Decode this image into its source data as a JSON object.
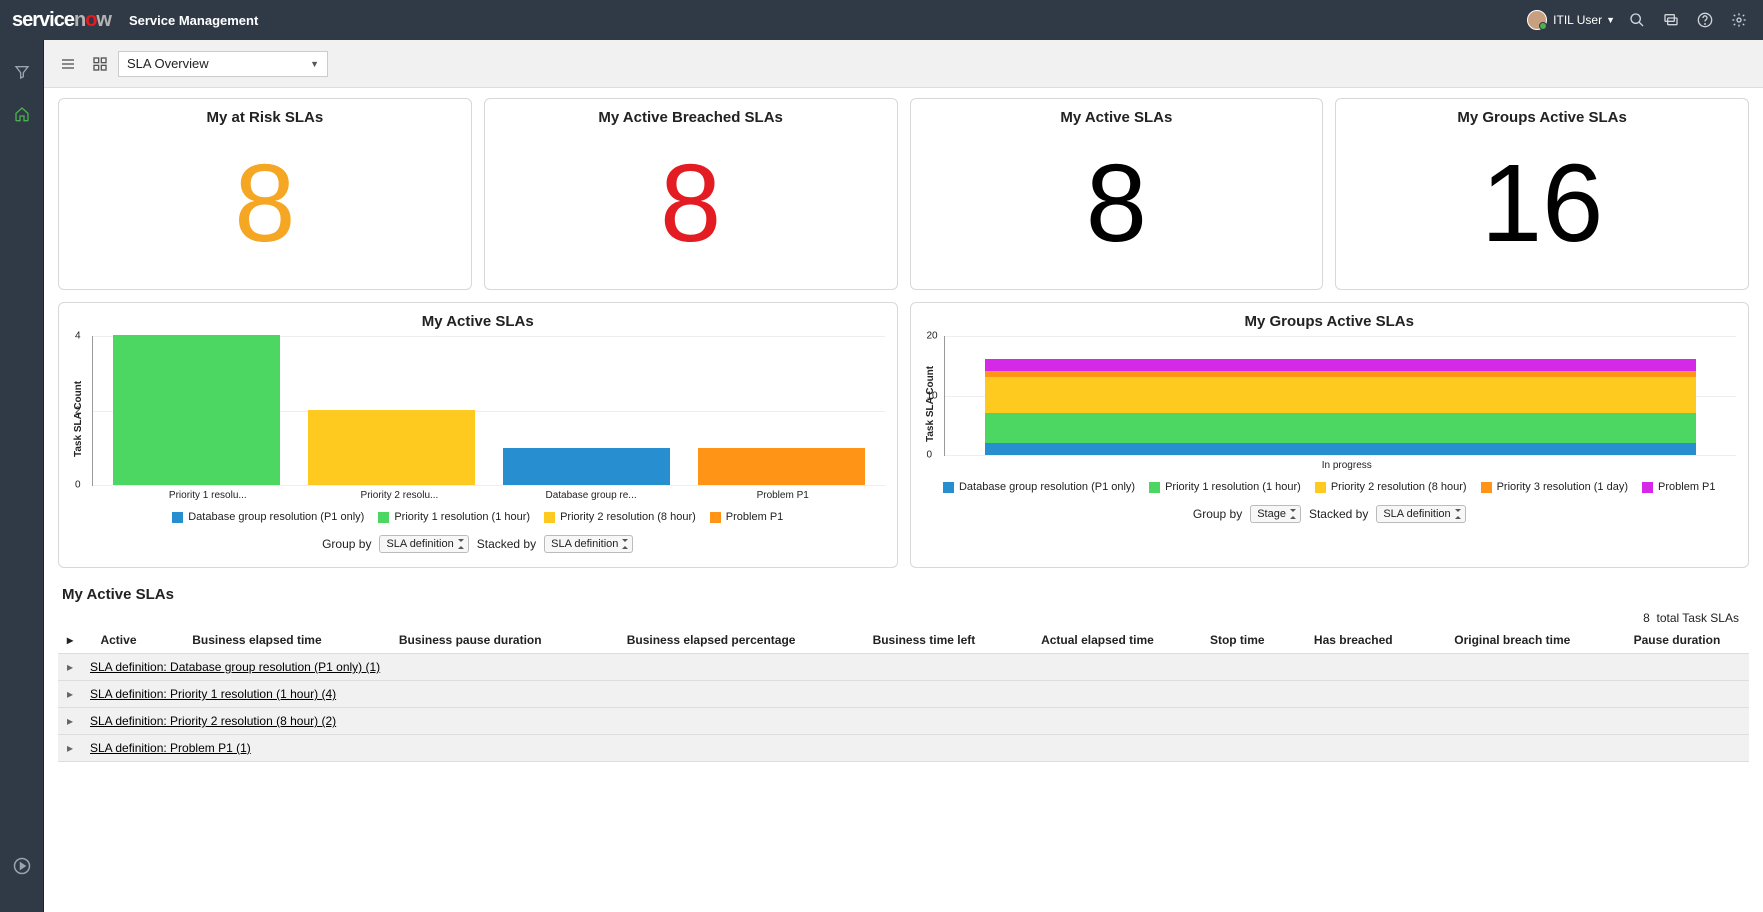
{
  "header": {
    "app_name": "Service Management",
    "user_name": "ITIL User"
  },
  "toolbar": {
    "dashboard_selected": "SLA Overview"
  },
  "kpis": [
    {
      "title": "My at Risk SLAs",
      "value": "8",
      "cls": "num-orange"
    },
    {
      "title": "My Active Breached SLAs",
      "value": "8",
      "cls": "num-red"
    },
    {
      "title": "My Active SLAs",
      "value": "8",
      "cls": "num-black"
    },
    {
      "title": "My Groups Active SLAs",
      "value": "16",
      "cls": "num-black"
    }
  ],
  "chart1": {
    "title": "My Active SLAs",
    "ylabel": "Task SLA Count",
    "groupby_label": "Group by",
    "groupby_value": "SLA definition",
    "stackedby_label": "Stacked by",
    "stackedby_value": "SLA definition",
    "legend": [
      {
        "label": "Database group resolution (P1 only)",
        "color": "c-blue"
      },
      {
        "label": "Priority 1 resolution (1 hour)",
        "color": "c-green"
      },
      {
        "label": "Priority 2 resolution (8 hour)",
        "color": "c-yellow"
      },
      {
        "label": "Problem P1",
        "color": "c-orange"
      }
    ],
    "bars": [
      {
        "label": "Priority 1 resolu...",
        "value": 4,
        "color": "c-green"
      },
      {
        "label": "Priority 2 resolu...",
        "value": 2,
        "color": "c-yellow"
      },
      {
        "label": "Database group re...",
        "value": 1,
        "color": "c-blue"
      },
      {
        "label": "Problem P1",
        "value": 1,
        "color": "c-orange"
      }
    ],
    "ymax": 4
  },
  "chart2": {
    "title": "My Groups Active SLAs",
    "ylabel": "Task SLA Count",
    "groupby_label": "Group by",
    "groupby_value": "Stage",
    "stackedby_label": "Stacked by",
    "stackedby_value": "SLA definition",
    "legend": [
      {
        "label": "Database group resolution (P1 only)",
        "color": "c-blue"
      },
      {
        "label": "Priority 1 resolution (1 hour)",
        "color": "c-green"
      },
      {
        "label": "Priority 2 resolution (8 hour)",
        "color": "c-yellow"
      },
      {
        "label": "Priority 3 resolution (1 day)",
        "color": "c-orange"
      },
      {
        "label": "Problem P1",
        "color": "c-magenta"
      }
    ],
    "category": "In progress",
    "stack": [
      {
        "color": "c-blue",
        "value": 2
      },
      {
        "color": "c-green",
        "value": 5
      },
      {
        "color": "c-yellow",
        "value": 6
      },
      {
        "color": "c-orange",
        "value": 1
      },
      {
        "color": "c-magenta",
        "value": 2
      }
    ],
    "ymax": 20
  },
  "list": {
    "title": "My Active SLAs",
    "total_count": "8",
    "total_label": "total Task SLAs",
    "columns": [
      "Active",
      "Business elapsed time",
      "Business pause duration",
      "Business elapsed percentage",
      "Business time left",
      "Actual elapsed time",
      "Stop time",
      "Has breached",
      "Original breach time",
      "Pause duration"
    ],
    "groups": [
      "SLA definition: Database group resolution (P1 only) (1)",
      "SLA definition: Priority 1 resolution (1 hour) (4)",
      "SLA definition: Priority 2 resolution (8 hour) (2)",
      "SLA definition: Problem P1 (1)"
    ]
  },
  "chart_data": [
    {
      "type": "bar",
      "title": "My Active SLAs",
      "ylabel": "Task SLA Count",
      "categories": [
        "Priority 1 resolution (1 hour)",
        "Priority 2 resolution (8 hour)",
        "Database group resolution (P1 only)",
        "Problem P1"
      ],
      "values": [
        4,
        2,
        1,
        1
      ],
      "ylim": [
        0,
        4
      ],
      "legend_position": "bottom"
    },
    {
      "type": "bar",
      "title": "My Groups Active SLAs",
      "ylabel": "Task SLA Count",
      "categories": [
        "In progress"
      ],
      "series": [
        {
          "name": "Database group resolution (P1 only)",
          "values": [
            2
          ]
        },
        {
          "name": "Priority 1 resolution (1 hour)",
          "values": [
            5
          ]
        },
        {
          "name": "Priority 2 resolution (8 hour)",
          "values": [
            6
          ]
        },
        {
          "name": "Priority 3 resolution (1 day)",
          "values": [
            1
          ]
        },
        {
          "name": "Problem P1",
          "values": [
            2
          ]
        }
      ],
      "ylim": [
        0,
        20
      ],
      "stacked": true,
      "legend_position": "bottom"
    }
  ]
}
